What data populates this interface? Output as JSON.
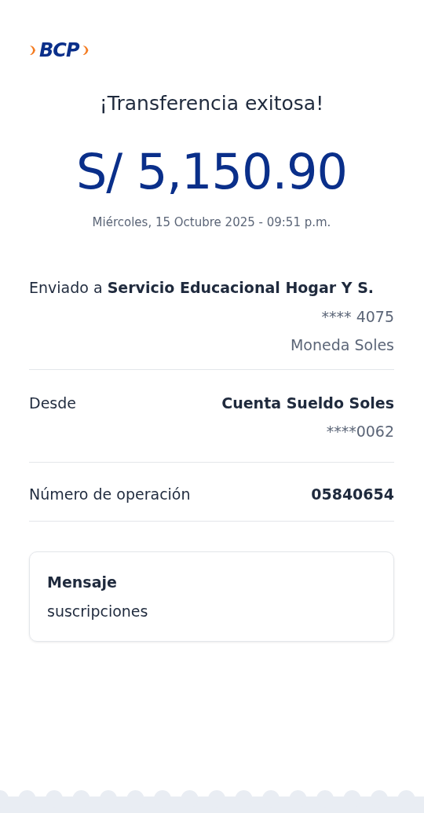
{
  "logo": {
    "text": "BCP"
  },
  "title": "¡Transferencia exitosa!",
  "amount": "S/ 5,150.90",
  "datetime": "Miércoles, 15 Octubre 2025 - 09:51 p.m.",
  "recipient": {
    "prefix": "Enviado a",
    "name": "Servicio Educacional Hogar Y S.",
    "account": "**** 4075",
    "currency": "Moneda Soles"
  },
  "details": [
    {
      "label": "Desde",
      "value": "Cuenta Sueldo Soles",
      "sub": "****0062"
    },
    {
      "label": "Número de operación",
      "value": "05840654"
    }
  ],
  "message": {
    "label": "Mensaje",
    "text": "suscripciones"
  }
}
